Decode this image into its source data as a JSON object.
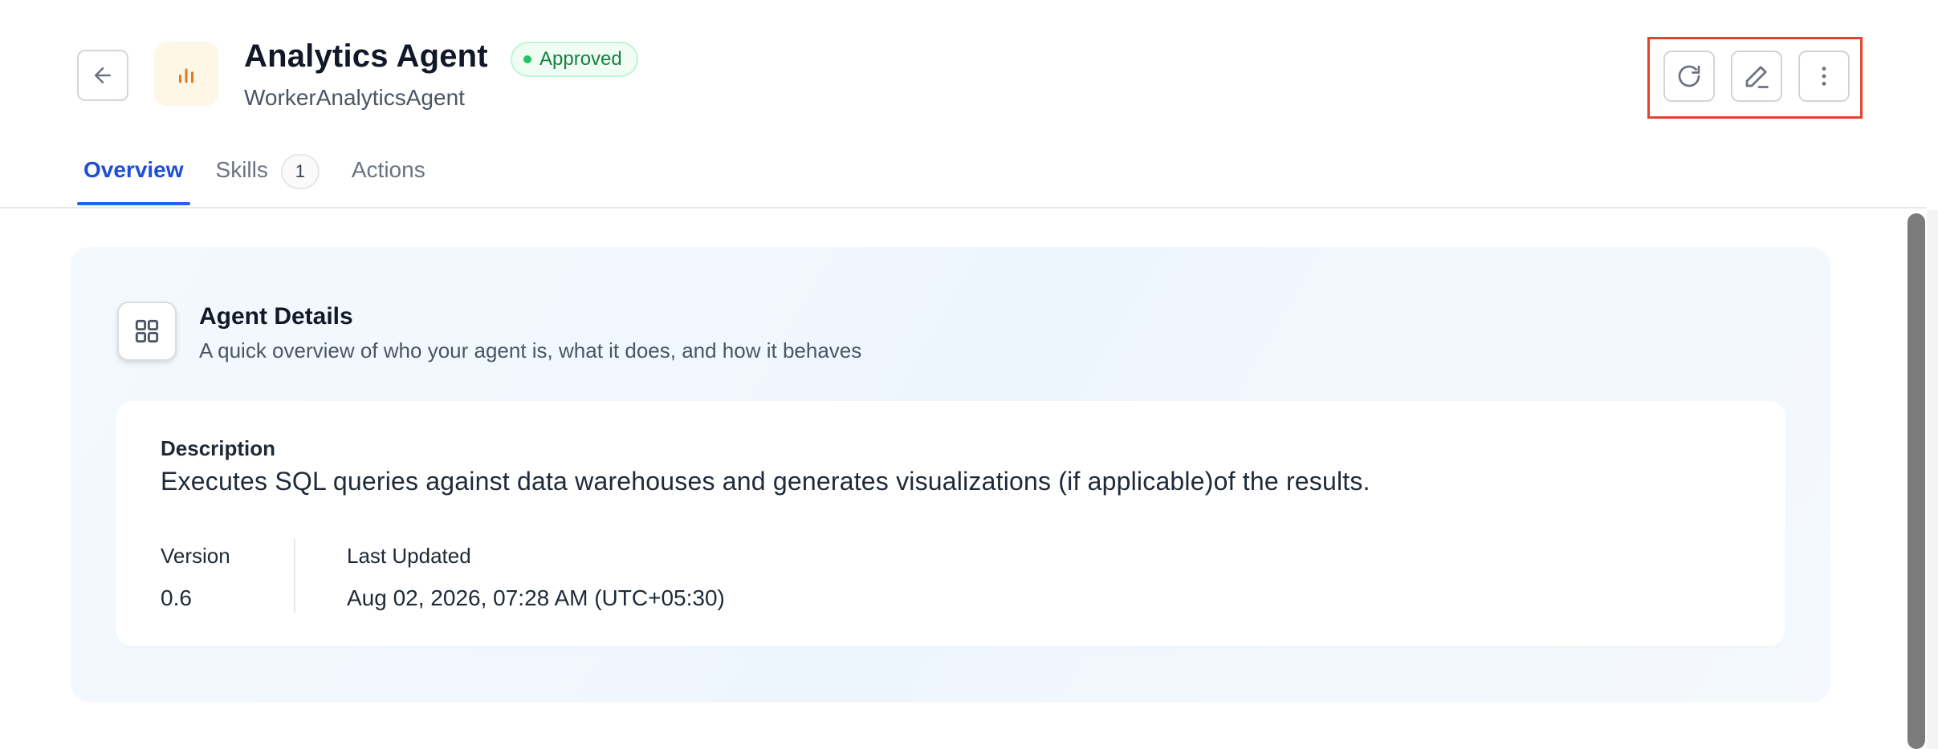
{
  "header": {
    "title": "Analytics Agent",
    "status": "Approved",
    "subtitle": "WorkerAnalyticsAgent",
    "back_icon": "arrow-left-icon",
    "avatar_icon": "bar-chart-icon"
  },
  "toolbar": {
    "refresh_icon": "refresh-icon",
    "edit_icon": "edit-pencil-icon",
    "more_icon": "more-vertical-icon"
  },
  "tabs": [
    {
      "label": "Overview",
      "active": true
    },
    {
      "label": "Skills",
      "count": "1"
    },
    {
      "label": "Actions"
    }
  ],
  "details": {
    "title": "Agent Details",
    "subtitle": "A quick overview of who your agent is, what it does, and how it behaves",
    "description_label": "Description",
    "description": "Executes SQL queries against data warehouses and generates visualizations (if applicable)of the results.",
    "version_label": "Version",
    "version": "0.6",
    "updated_label": "Last Updated",
    "updated": "Aug 02, 2026, 07:28 AM (UTC+05:30)"
  },
  "colors": {
    "accent": "#2563eb",
    "status_green": "#22c55e",
    "highlight_box": "#e0442c",
    "avatar_orange": "#e07a1f"
  }
}
